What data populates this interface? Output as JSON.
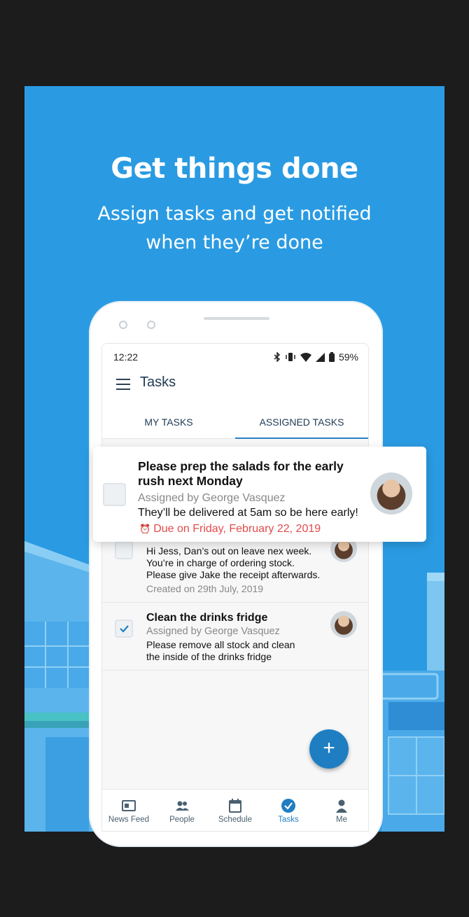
{
  "promo": {
    "headline": "Get things done",
    "subline1": "Assign tasks and get notified",
    "subline2": "when they’re done"
  },
  "status_bar": {
    "time": "12:22",
    "battery": "59%"
  },
  "app": {
    "title": "Tasks",
    "tabs": [
      {
        "label": "MY TASKS",
        "active": false
      },
      {
        "label": "ASSIGNED TASKS",
        "active": true
      }
    ]
  },
  "featured_task": {
    "title": "Please prep the salads for the early rush next Monday",
    "assigned_by": "Assigned by George Vasquez",
    "body": "They’ll be delivered at 5am so be here early!",
    "due": "Due on Friday, February 22, 2019",
    "checked": false
  },
  "tasks": [
    {
      "body_lines": [
        "Hi Jess, Dan’s out on leave nex week.",
        "You’re in charge of ordering stock.",
        "Please give Jake the receipt afterwards."
      ],
      "created": "Created on 29th July, 2019",
      "checked": false
    },
    {
      "title": "Clean the drinks fridge",
      "assigned_by": "Assigned by George Vasquez",
      "body_lines": [
        "Please remove all stock and clean",
        "the inside of the drinks fridge"
      ],
      "checked": true
    }
  ],
  "fab": {
    "icon": "plus-icon",
    "label": "+"
  },
  "nav": [
    {
      "label": "News Feed",
      "icon": "news-feed-icon",
      "active": false
    },
    {
      "label": "People",
      "icon": "people-icon",
      "active": false
    },
    {
      "label": "Schedule",
      "icon": "calendar-icon",
      "active": false
    },
    {
      "label": "Tasks",
      "icon": "check-circle-icon",
      "active": true
    },
    {
      "label": "Me",
      "icon": "person-icon",
      "active": false
    }
  ],
  "colors": {
    "banner": "#2a9be2",
    "accent": "#1f7ec2",
    "due": "#e24b4b"
  }
}
